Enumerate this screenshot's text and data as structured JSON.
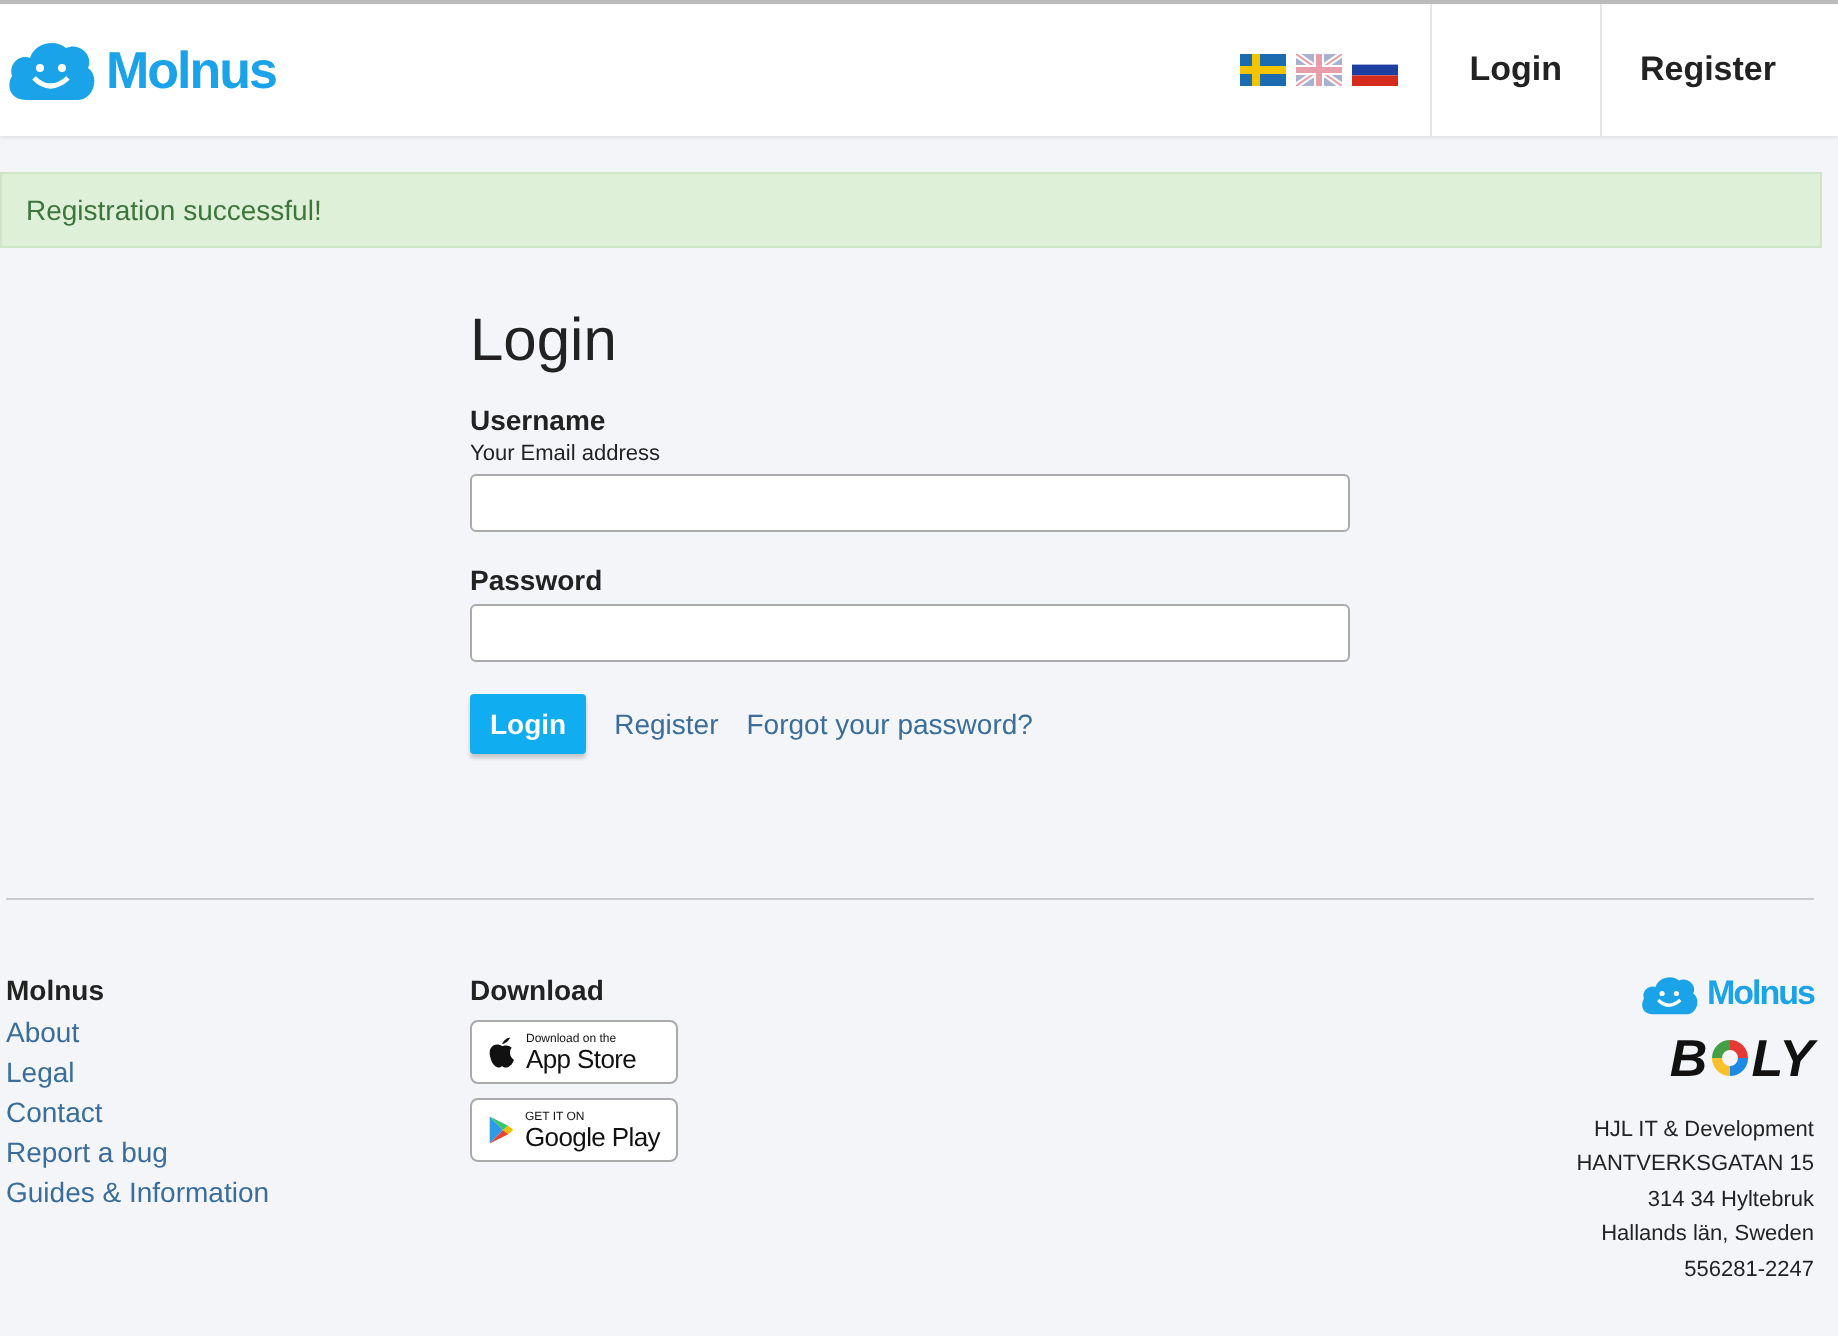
{
  "header": {
    "brand": "Molnus",
    "flags": [
      {
        "kind": "sweden",
        "selected": false
      },
      {
        "kind": "uk",
        "selected": true
      },
      {
        "kind": "russia",
        "selected": false
      }
    ],
    "nav": [
      "Login",
      "Register"
    ]
  },
  "alert": "Registration successful!",
  "form": {
    "title": "Login",
    "fields": [
      {
        "label": "Username",
        "hint": "Your Email address"
      },
      {
        "label": "Password"
      }
    ],
    "submit": "Login",
    "links": [
      "Register",
      "Forgot your password?"
    ]
  },
  "footer": {
    "links_title": "Molnus",
    "links": [
      "About",
      "Legal",
      "Contact",
      "Report a bug",
      "Guides & Information"
    ],
    "download_title": "Download",
    "badges": [
      {
        "kind": "apple",
        "small": "Download on the",
        "big": "App Store"
      },
      {
        "kind": "google",
        "small": "GET IT ON",
        "big": "Google Play"
      }
    ],
    "brand": "Molnus",
    "partner": {
      "before": "B",
      "after": "LY"
    },
    "address": [
      "HJL IT & Development",
      "HANTVERKSGATAN 15",
      "314 34 Hyltebruk",
      "Hallands län, Sweden",
      "556281-2247"
    ]
  }
}
